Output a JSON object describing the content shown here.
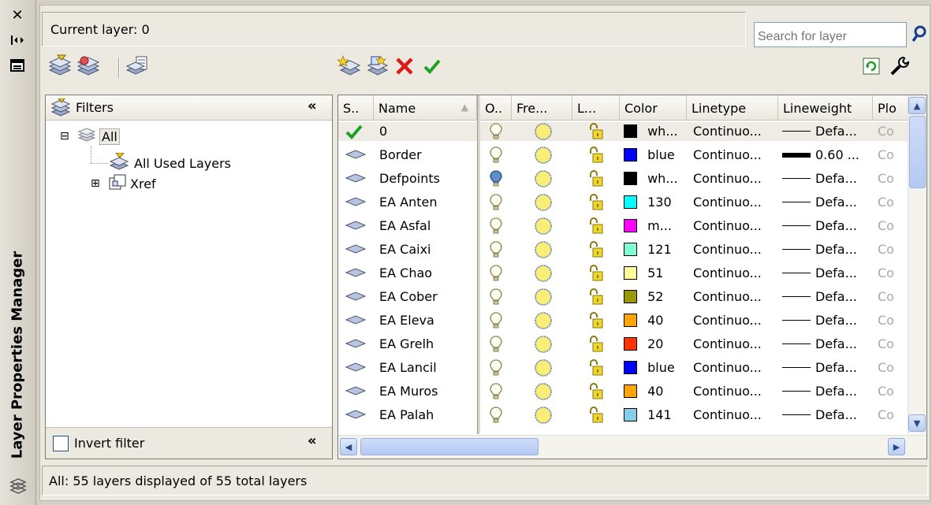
{
  "palette_title": "Layer Properties Manager",
  "current_layer": "Current layer: 0",
  "search": {
    "placeholder": "Search for layer"
  },
  "filters": {
    "header": "Filters",
    "collapse_glyph": "«",
    "tree": [
      {
        "label": "All",
        "expander": "⊟"
      },
      {
        "label": "All Used Layers",
        "expander": ""
      },
      {
        "label": "Xref",
        "expander": "⊞"
      }
    ],
    "invert_label": "Invert filter",
    "invert_checked": false
  },
  "columns": [
    "S..",
    "Name",
    "O..",
    "Fre...",
    "L...",
    "Color",
    "Linetype",
    "Lineweight",
    "Plo"
  ],
  "layers": [
    {
      "name": "0",
      "current": true,
      "on": true,
      "color_hex": "#000000",
      "color": "wh...",
      "linetype": "Continuo...",
      "lw_style": "thin",
      "lineweight": "Defa...",
      "plot": "Co"
    },
    {
      "name": "Border",
      "current": false,
      "on": true,
      "color_hex": "#0000ff",
      "color": "blue",
      "linetype": "Continuo...",
      "lw_style": "thick",
      "lineweight": "0.60 ...",
      "plot": "Co"
    },
    {
      "name": "Defpoints",
      "current": false,
      "on": true,
      "color_hex": "#000000",
      "color": "wh...",
      "linetype": "Continuo...",
      "lw_style": "thin",
      "lineweight": "Defa...",
      "plot": "Co"
    },
    {
      "name": "EA Anten",
      "current": false,
      "on": true,
      "color_hex": "#00ffff",
      "color": "130",
      "linetype": "Continuo...",
      "lw_style": "thin",
      "lineweight": "Defa...",
      "plot": "Co"
    },
    {
      "name": "EA Asfal",
      "current": false,
      "on": true,
      "color_hex": "#ff00ff",
      "color": "m...",
      "linetype": "Continuo...",
      "lw_style": "thin",
      "lineweight": "Defa...",
      "plot": "Co"
    },
    {
      "name": "EA Caixi",
      "current": false,
      "on": true,
      "color_hex": "#7fffd4",
      "color": "121",
      "linetype": "Continuo...",
      "lw_style": "thin",
      "lineweight": "Defa...",
      "plot": "Co"
    },
    {
      "name": "EA Chao",
      "current": false,
      "on": true,
      "color_hex": "#ffff99",
      "color": "51",
      "linetype": "Continuo...",
      "lw_style": "thin",
      "lineweight": "Defa...",
      "plot": "Co"
    },
    {
      "name": "EA Cober",
      "current": false,
      "on": true,
      "color_hex": "#999900",
      "color": "52",
      "linetype": "Continuo...",
      "lw_style": "thin",
      "lineweight": "Defa...",
      "plot": "Co"
    },
    {
      "name": "EA Eleva",
      "current": false,
      "on": true,
      "color_hex": "#ffa500",
      "color": "40",
      "linetype": "Continuo...",
      "lw_style": "thin",
      "lineweight": "Defa...",
      "plot": "Co"
    },
    {
      "name": "EA Grelh",
      "current": false,
      "on": true,
      "color_hex": "#ff3300",
      "color": "20",
      "linetype": "Continuo...",
      "lw_style": "thin",
      "lineweight": "Defa...",
      "plot": "Co"
    },
    {
      "name": "EA Lancil",
      "current": false,
      "on": true,
      "color_hex": "#0000ff",
      "color": "blue",
      "linetype": "Continuo...",
      "lw_style": "thin",
      "lineweight": "Defa...",
      "plot": "Co"
    },
    {
      "name": "EA Muros",
      "current": false,
      "on": true,
      "color_hex": "#ffa500",
      "color": "40",
      "linetype": "Continuo...",
      "lw_style": "thin",
      "lineweight": "Defa...",
      "plot": "Co"
    },
    {
      "name": "EA Palah",
      "current": false,
      "on": true,
      "color_hex": "#87ceeb",
      "color": "141",
      "linetype": "Continuo...",
      "lw_style": "thin",
      "lineweight": "Defa...",
      "plot": "Co"
    }
  ],
  "status": "All: 55 layers displayed of 55 total layers"
}
